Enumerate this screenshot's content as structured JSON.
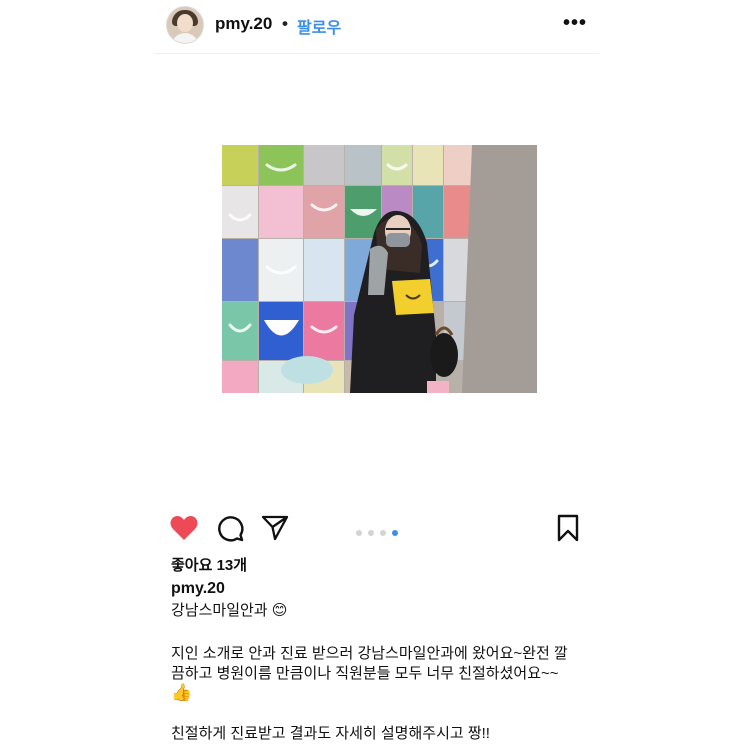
{
  "header": {
    "username": "pmy.20",
    "separator": "•",
    "follow_label": "팔로우",
    "more_label": "•••"
  },
  "post": {
    "likes": "좋아요 13개",
    "carousel": {
      "count": 4,
      "active_index": 3
    },
    "caption": {
      "username": "pmy.20",
      "title": "강남스마일안과 😊",
      "body_line1": "지인 소개로 안과 진료 받으러 강남스마일안과에 왔어요~완전 깔",
      "body_line2": "끔하고 병원이름 만큼이나 직원분들 모두 너무 친절하셨어요~~",
      "body_line3": "👍",
      "body_line4": "친절하게 진료받고 결과도 자세히 설명해주시고 짱!!"
    }
  },
  "icons": {
    "like": "heart-icon",
    "comment": "comment-icon",
    "share": "send-icon",
    "save": "bookmark-icon",
    "more": "more-icon"
  },
  "colors": {
    "like_red": "#ed4956",
    "follow_blue": "#3b8fe8"
  }
}
